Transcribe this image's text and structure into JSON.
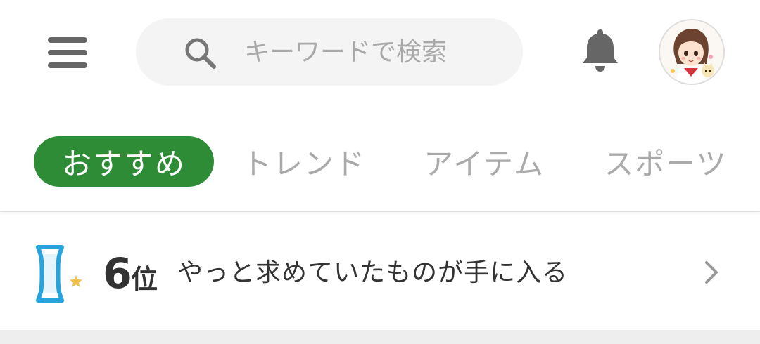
{
  "header": {
    "menu_icon": "hamburger-menu-icon",
    "search": {
      "placeholder": "キーワードで検索",
      "value": "",
      "icon": "search-icon"
    },
    "notification_icon": "bell-icon",
    "avatar_icon": "user-avatar"
  },
  "tabs": [
    {
      "label": "おすすめ",
      "active": true
    },
    {
      "label": "トレンド",
      "active": false
    },
    {
      "label": "アイテム",
      "active": false
    },
    {
      "label": "スポーツ",
      "active": false
    }
  ],
  "ranking": {
    "icon": "rank-badge-icon",
    "rank_number": "6",
    "rank_unit": "位",
    "title": "やっと求めていたものが手に入る",
    "chevron_icon": "chevron-right-icon"
  },
  "colors": {
    "accent_green": "#2e8b36",
    "icon_gray": "#666666",
    "tab_inactive": "#aaaaaa",
    "rank_icon_blue": "#29a3dc",
    "star_yellow": "#f0c14b"
  }
}
